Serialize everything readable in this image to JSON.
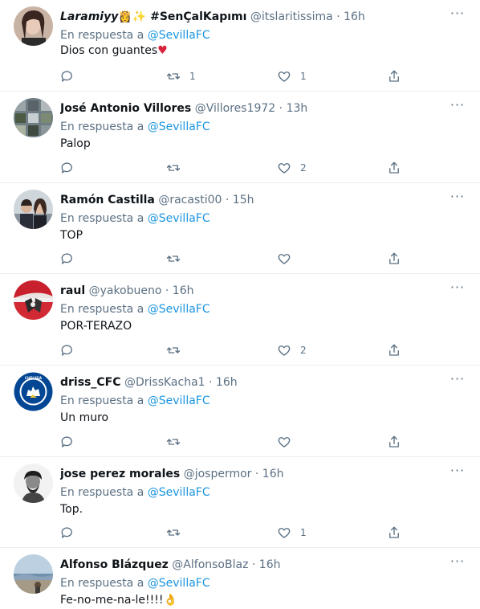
{
  "reply_prefix": "En respuesta a",
  "reply_to": "@SevillaFC",
  "tweets": [
    {
      "name": "Laramiyy",
      "name_emoji": "👸✨",
      "name_extra": "#SenÇalKapımı",
      "handle": "@itslaritissima",
      "time": "16h",
      "text": "Dios con guantes",
      "text_emoji": "♥",
      "retweets": "1",
      "likes": "1"
    },
    {
      "name": "José Antonio Villores",
      "name_emoji": "",
      "name_extra": "",
      "handle": "@Villores1972",
      "time": "13h",
      "text": "Palop",
      "text_emoji": "",
      "retweets": "",
      "likes": "2"
    },
    {
      "name": "Ramón Castilla",
      "name_emoji": "",
      "name_extra": "",
      "handle": "@racasti00",
      "time": "15h",
      "text": "TOP",
      "text_emoji": "",
      "retweets": "",
      "likes": ""
    },
    {
      "name": "raul",
      "name_emoji": "",
      "name_extra": "",
      "handle": "@yakobueno",
      "time": "16h",
      "text": "POR-TERAZO",
      "text_emoji": "",
      "retweets": "",
      "likes": "2"
    },
    {
      "name": "driss_CFC",
      "name_emoji": "",
      "name_extra": "",
      "handle": "@DrissKacha1",
      "time": "16h",
      "text": "Un muro",
      "text_emoji": "",
      "retweets": "",
      "likes": ""
    },
    {
      "name": "jose perez morales",
      "name_emoji": "",
      "name_extra": "",
      "handle": "@jospermor",
      "time": "16h",
      "text": "Top.",
      "text_emoji": "",
      "retweets": "",
      "likes": "1"
    },
    {
      "name": "Alfonso Blázquez",
      "name_emoji": "",
      "name_extra": "",
      "handle": "@AlfonsoBlaz",
      "time": "16h",
      "text": "Fe-no-me-na-le!!!!",
      "text_emoji": "👌",
      "retweets": "",
      "likes": ""
    }
  ]
}
